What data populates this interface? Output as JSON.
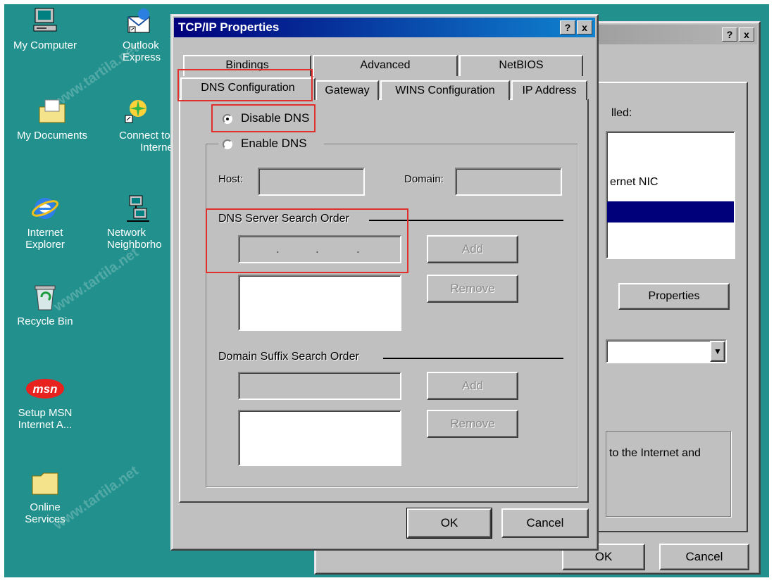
{
  "desktop": {
    "icons": [
      {
        "label": "My Computer"
      },
      {
        "label": "Outlook\nExpress"
      },
      {
        "label": "My Documents"
      },
      {
        "label": "Connect to t\nInternet"
      },
      {
        "label": "Internet\nExplorer"
      },
      {
        "label": "Network\nNeighborho"
      },
      {
        "label": "Recycle Bin"
      },
      {
        "label": "Setup MSN\nInternet A..."
      },
      {
        "label": "Online\nServices"
      }
    ],
    "msn_logo": "msn",
    "watermark": "www.tartila.net"
  },
  "back_window": {
    "help": "?",
    "close": "x",
    "list_label": "lled:",
    "list_item": "ernet NIC",
    "properties_label": "Properties",
    "desc_text": "to the Internet and",
    "ok_label": "OK",
    "cancel_label": "Cancel"
  },
  "dialog": {
    "title": "TCP/IP Properties",
    "help": "?",
    "close": "x",
    "tabs_row1": [
      "Bindings",
      "Advanced",
      "NetBIOS"
    ],
    "tabs_row2": [
      "DNS Configuration",
      "Gateway",
      "WINS Configuration",
      "IP Address"
    ],
    "disable_dns": "Disable DNS",
    "enable_dns": "Enable DNS",
    "host_label": "Host:",
    "domain_label": "Domain:",
    "dns_order_label": "DNS Server Search Order",
    "add_label": "Add",
    "remove_label": "Remove",
    "suffix_label": "Domain Suffix Search Order",
    "add2_label": "Add",
    "remove2_label": "Remove",
    "ok_label": "OK",
    "cancel_label": "Cancel"
  },
  "colors": {
    "desktop": "#22918e",
    "highlight": "#e0302c",
    "selection": "#00007b"
  }
}
